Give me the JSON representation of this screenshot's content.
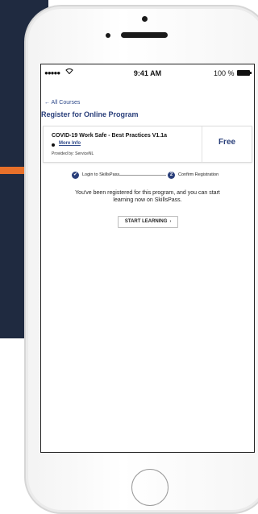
{
  "status_bar": {
    "signal": "●●●●●",
    "wifi_icon": "wifi-icon",
    "time": "9:41 AM",
    "battery_pct": "100 %"
  },
  "nav": {
    "back_label": "← All Courses"
  },
  "page": {
    "title": "Register for Online Program"
  },
  "course_card": {
    "title": "COVID-19 Work Safe - Best Practices V1.1a",
    "more_info": "More Info",
    "provided_by": "Provided by: ServiceNL",
    "price": "Free"
  },
  "steps": [
    {
      "label": "Login to SkillsPass",
      "marker": "✔"
    },
    {
      "label": "Confirm Registration",
      "marker": "2"
    }
  ],
  "message": "You've been registered for this program, and you can start learning now on SkillsPass.",
  "start_button": {
    "label": "START LEARNING",
    "chevron": "›"
  },
  "colors": {
    "primary": "#2a3f7a",
    "background_navy": "#1f2a40",
    "accent_orange": "#e8702a"
  }
}
